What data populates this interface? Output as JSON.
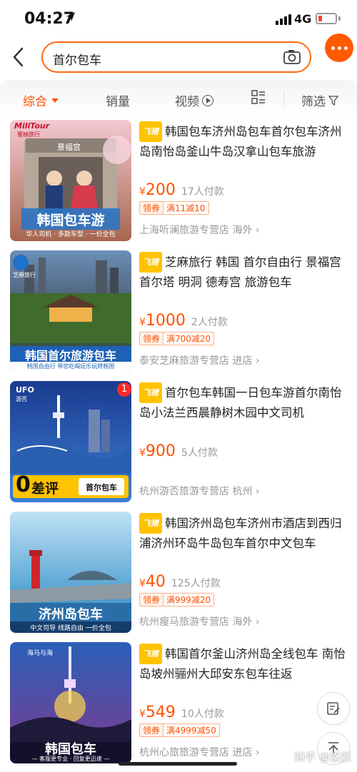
{
  "status_bar": {
    "time": "04:27",
    "network": "4G"
  },
  "search": {
    "query": "首尔包车"
  },
  "filters": {
    "tabs": [
      {
        "label": "综合"
      },
      {
        "label": "销量"
      },
      {
        "label": "视频"
      },
      {
        "label": "筛选"
      }
    ]
  },
  "products": [
    {
      "tag": "飞猪",
      "title": "韩国包车济州岛包车首尔包车济州岛南怡岛釜山牛岛汉拿山包车旅游",
      "currency": "¥",
      "price": "200",
      "sold": "17人付款",
      "coupon_label": "领券",
      "coupon_value": "满11减10",
      "shop": "上海听澜旅游专营店 海外 ›",
      "thumb": {
        "brand": "MiliTour",
        "brand_sub": "蜜柚旅行",
        "sign": "景福宫",
        "banner": "韩国包车游",
        "subline": "华人司机 · 多款车型 · 一价全包"
      }
    },
    {
      "tag": "飞猪",
      "title": "芝麻旅行 韩国 首尔自由行 景福宫 首尔塔 明洞 德寿宫 旅游包车",
      "currency": "¥",
      "price": "1000",
      "sold": "2人付款",
      "coupon_label": "领券",
      "coupon_value": "满700减20",
      "shop": "泰安芝麻旅游专营店 进店 ›",
      "thumb": {
        "brand": "芝麻旅行",
        "banner": "韩国首尔旅游包车",
        "subline": "韩国自由行  带您吃喝玩乐玩转韩国"
      }
    },
    {
      "tag": "飞猪",
      "title": "首尔包车韩国一日包车游首尔南怡岛小法兰西晨静树木园中文司机",
      "currency": "¥",
      "price": "900",
      "sold": "5人付款",
      "coupon_label": "",
      "coupon_value": "",
      "shop": "杭州游否旅游专营店 杭州 ›",
      "thumb": {
        "brand": "UFO",
        "brand_sub": "游否",
        "badge": "1",
        "big": "0",
        "big_suffix": "差评",
        "pill": "首尔包车"
      }
    },
    {
      "tag": "飞猪",
      "title": "韩国济州岛包车济州市酒店到西归浦济州环岛牛岛包车首尔中文包车",
      "currency": "¥",
      "price": "40",
      "sold": "125人付款",
      "coupon_label": "领券",
      "coupon_value": "满999减20",
      "shop": "杭州瘦马旅游专营店 海外 ›",
      "thumb": {
        "banner": "济州岛包车",
        "subline": "中文司导  线路自由  一价全包"
      }
    },
    {
      "tag": "飞猪",
      "title": "韩国首尔釜山济州岛全线包车 南怡岛坡州骊州大邱安东包车往返",
      "currency": "¥",
      "price": "549",
      "sold": "10人付款",
      "coupon_label": "领券",
      "coupon_value": "满4999减50",
      "shop": "杭州心旅旅游专营店 进店 ›",
      "thumb": {
        "brand": "海马与海",
        "banner": "韩国包车",
        "subline": "— 客服更专业 · 回复更迅速 —"
      }
    }
  ],
  "watermark": "知乎 @悠然",
  "colors": {
    "accent": "#ff5000",
    "tag": "#ffc300",
    "search_border": "#ff6a13"
  }
}
